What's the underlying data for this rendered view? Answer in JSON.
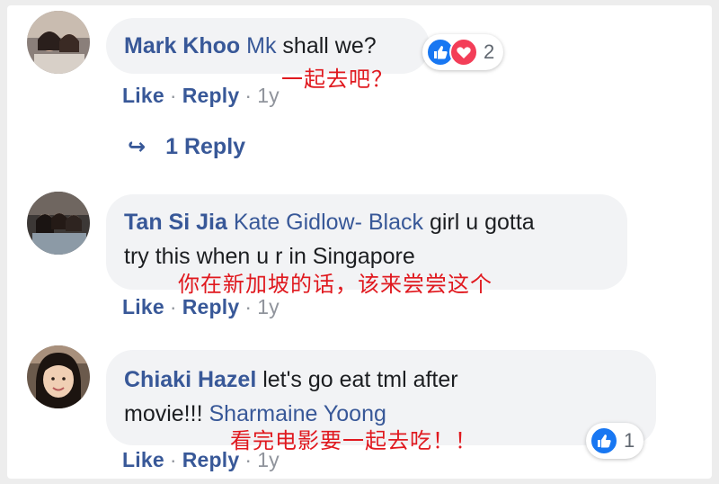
{
  "comments": [
    {
      "author": "Mark Khoo",
      "tag": "Mk",
      "text": " shall we?",
      "translation": "一起去吧？",
      "actions": {
        "like": "Like",
        "reply": "Reply",
        "time": "1y",
        "sep": "·"
      },
      "reactions": {
        "icons": [
          "like-icon",
          "love-icon"
        ],
        "count": "2"
      },
      "replies_link": "1 Reply"
    },
    {
      "author": "Tan Si Jia",
      "tag": "Kate Gidlow- Black",
      "text_line1": " girl u gotta",
      "text_line2": "try this when u r in Singapore",
      "translation": "你在新加坡的话，该来尝尝这个",
      "actions": {
        "like": "Like",
        "reply": "Reply",
        "time": "1y",
        "sep": "·"
      }
    },
    {
      "author": "Chiaki Hazel",
      "text_line1": " let's go eat tml after",
      "text_line2": "movie!!! ",
      "tag": "Sharmaine Yoong",
      "translation": "看完电影要一起去吃！！",
      "actions": {
        "like": "Like",
        "reply": "Reply",
        "time": "1y",
        "sep": "·"
      },
      "reactions": {
        "icons": [
          "like-icon"
        ],
        "count": "1"
      }
    }
  ],
  "colors": {
    "name_blue": "#385898",
    "bubble_gray": "#f2f3f5",
    "translation_red": "#e0191f",
    "like_blue": "#1877f2",
    "love_red": "#f33e58"
  }
}
